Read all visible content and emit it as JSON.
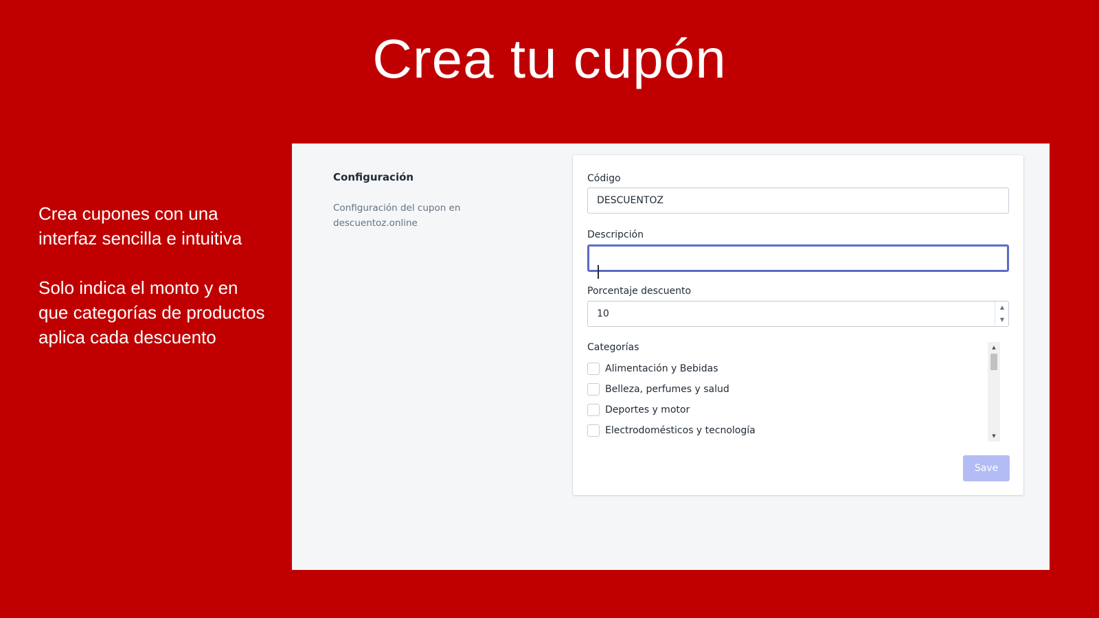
{
  "slide": {
    "title": "Crea tu cupón",
    "paragraph_1": "Crea cupones con una interfaz sencilla e intuitiva",
    "paragraph_2": "Solo indica el monto y en que categorías de productos aplica cada descuento"
  },
  "section": {
    "heading": "Configuración",
    "description": "Configuración del cupon en descuentoz.online"
  },
  "form": {
    "code_label": "Código",
    "code_value": "DESCUENTOZ",
    "description_label": "Descripción",
    "description_value": "",
    "discount_label": "Porcentaje descuento",
    "discount_value": "10",
    "categories_label": "Categorías",
    "categories": [
      {
        "label": "Alimentación y Bebidas",
        "checked": false
      },
      {
        "label": "Belleza, perfumes y salud",
        "checked": false
      },
      {
        "label": "Deportes y motor",
        "checked": false
      },
      {
        "label": "Electrodomésticos y tecnología",
        "checked": false
      }
    ],
    "save_label": "Save"
  },
  "icons": {
    "stepper_up": "▲",
    "stepper_down": "▼",
    "scroll_up": "▲",
    "scroll_down": "▼"
  },
  "colors": {
    "slide_background": "#c00000",
    "focus_border": "#5c6ac4",
    "save_disabled": "#b3bcf5"
  }
}
